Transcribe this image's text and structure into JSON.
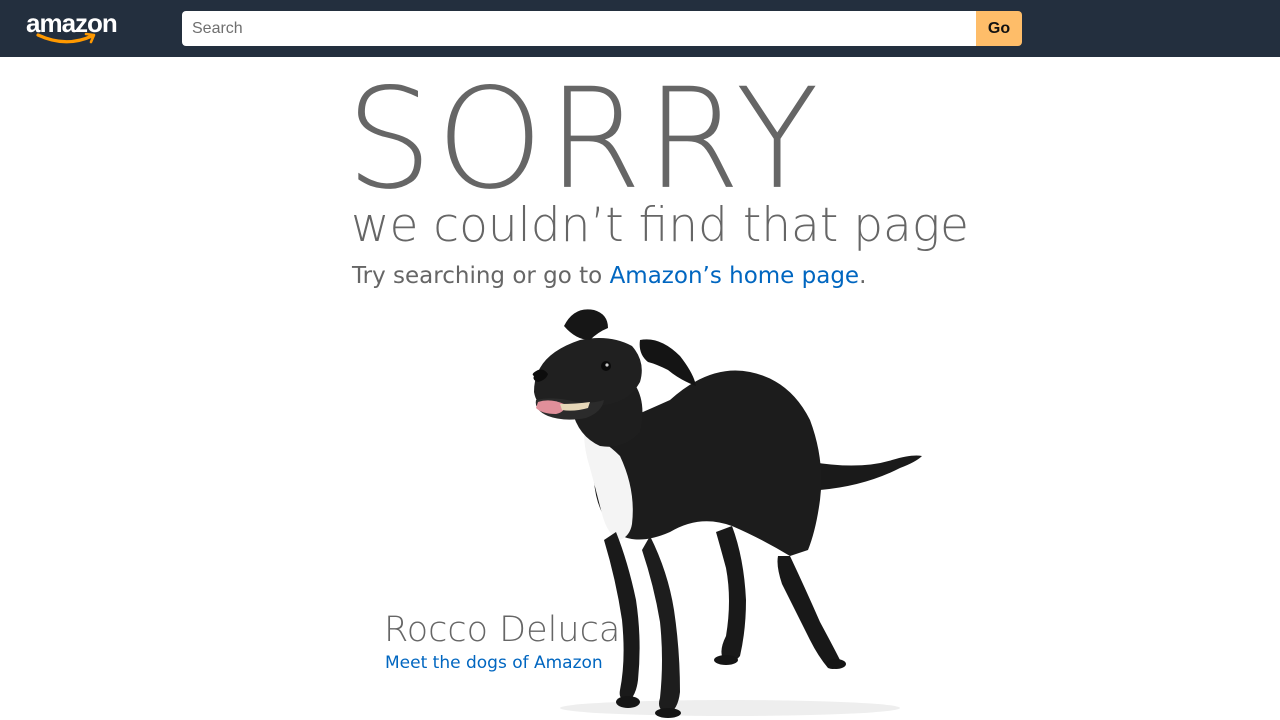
{
  "header": {
    "logo_text": "amazon",
    "search": {
      "placeholder": "Search",
      "value": ""
    },
    "go_label": "Go"
  },
  "main": {
    "headline": "SORRY",
    "subhead": "we couldn’t find that page",
    "try_prefix": "Try searching or go to ",
    "home_link": "Amazon’s home page",
    "try_suffix": ".",
    "dog_name": "Rocco Deluca",
    "dog_link": "Meet the dogs of Amazon"
  },
  "colors": {
    "topbar": "#232f3e",
    "go_button": "#febd69",
    "link": "#0066c0",
    "text_gray": "#666666",
    "smile": "#ff9900"
  },
  "icons": {
    "logo": "amazon-smile-logo",
    "dog": "black-dog-photo"
  }
}
